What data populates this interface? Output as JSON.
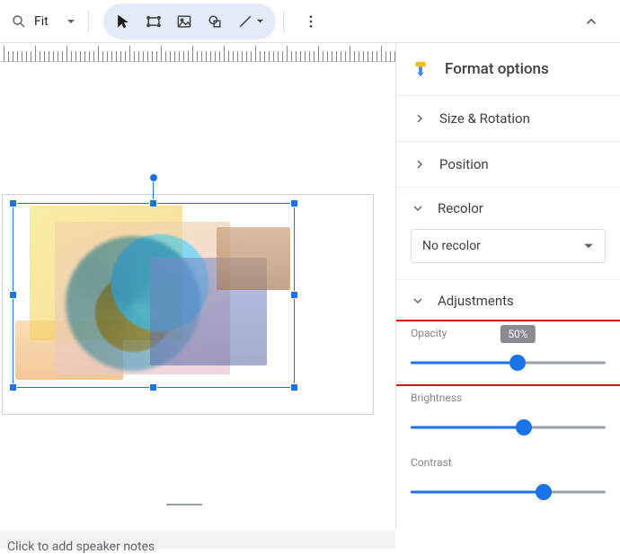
{
  "toolbar": {
    "zoom_label": "Fit"
  },
  "panel": {
    "title": "Format options",
    "sections": {
      "size_rotation": "Size & Rotation",
      "position": "Position",
      "recolor": "Recolor",
      "recolor_value": "No recolor",
      "adjustments": "Adjustments"
    }
  },
  "adjustments": {
    "opacity": {
      "label": "Opacity",
      "value": 50,
      "tooltip": "50%"
    },
    "brightness": {
      "label": "Brightness",
      "value": 50
    },
    "contrast": {
      "label": "Contrast",
      "value": 60
    }
  },
  "notes_placeholder": "Click to add speaker notes"
}
